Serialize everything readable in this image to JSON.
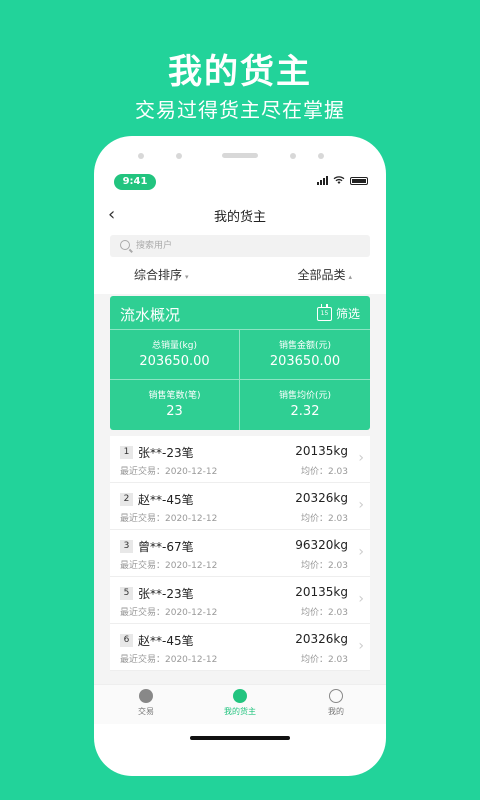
{
  "promo": {
    "title": "我的货主",
    "subtitle": "交易过得货主尽在掌握"
  },
  "status": {
    "time": "9:41"
  },
  "nav": {
    "back_icon": "‹",
    "title": "我的货主"
  },
  "search": {
    "placeholder": "搜索用户"
  },
  "sort": {
    "left_label": "综合排序",
    "right_label": "全部品类",
    "left_caret": "▾",
    "right_caret": "▴"
  },
  "summary": {
    "title": "流水概况",
    "filter_label": "筛选",
    "calendar_day": "15",
    "cells": [
      {
        "label": "总销量(kg)",
        "value": "203650.00"
      },
      {
        "label": "销售金额(元)",
        "value": "203650.00"
      },
      {
        "label": "销售笔数(笔)",
        "value": "23"
      },
      {
        "label": "销售均价(元)",
        "value": "2.32"
      }
    ]
  },
  "list": {
    "chevron": "›",
    "rows": [
      {
        "rank": "1",
        "name": "张**-23笔",
        "weight": "20135kg",
        "recent": "最近交易：2020-12-12",
        "avg": "均价：2.03"
      },
      {
        "rank": "2",
        "name": "赵**-45笔",
        "weight": "20326kg",
        "recent": "最近交易：2020-12-12",
        "avg": "均价：2.03"
      },
      {
        "rank": "3",
        "name": "曾**-67笔",
        "weight": "96320kg",
        "recent": "最近交易：2020-12-12",
        "avg": "均价：2.03"
      },
      {
        "rank": "5",
        "name": "张**-23笔",
        "weight": "20135kg",
        "recent": "最近交易：2020-12-12",
        "avg": "均价：2.03"
      },
      {
        "rank": "6",
        "name": "赵**-45笔",
        "weight": "20326kg",
        "recent": "最近交易：2020-12-12",
        "avg": "均价：2.03"
      }
    ]
  },
  "tabbar": {
    "tabs": [
      {
        "label": "交易",
        "icon": "trade-icon"
      },
      {
        "label": "我的货主",
        "icon": "shipper-icon"
      },
      {
        "label": "我的",
        "icon": "profile-icon"
      }
    ]
  },
  "colors": {
    "accent": "#22d39a",
    "card": "#2fcf93",
    "active_tab": "#22c47f"
  }
}
